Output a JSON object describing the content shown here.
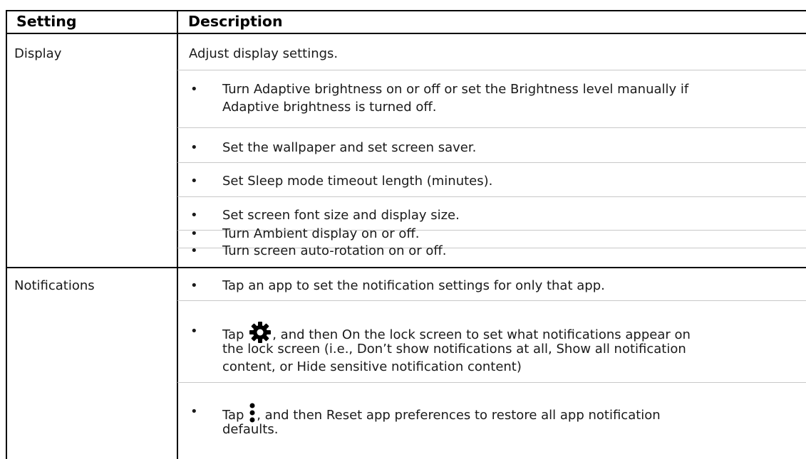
{
  "table": {
    "headers": {
      "setting": "Setting",
      "description": "Description"
    },
    "rows": [
      {
        "setting": "Display",
        "intro": "Adjust display settings.",
        "bullets": [
          [
            "Turn Adaptive brightness on or off or set the Brightness level manually if",
            "Adaptive brightness is turned off."
          ],
          [
            "Set the wallpaper and set screen saver."
          ],
          [
            "Set Sleep mode timeout length (minutes)."
          ],
          [
            "Set screen font size and display size."
          ],
          [
            "Turn Ambient display on or off."
          ],
          [
            "Turn screen auto-rotation on or off."
          ]
        ]
      },
      {
        "setting": "Notifications",
        "bullets": [
          {
            "lines": [
              "Tap an app to set the notification settings for only that app."
            ]
          },
          {
            "before_icon": "Tap",
            "icon": "gear-icon",
            "after_icon": ", and then On the lock screen to set what notifications appear on",
            "lines": [
              "the lock screen (i.e., Don’t show notifications at all, Show all notification",
              "content, or Hide sensitive notification content)"
            ]
          },
          {
            "before_icon": "Tap",
            "icon": "more-vert-icon",
            "after_icon": ", and then Reset app preferences to restore all app notification",
            "lines": [
              "defaults."
            ]
          }
        ]
      }
    ]
  }
}
